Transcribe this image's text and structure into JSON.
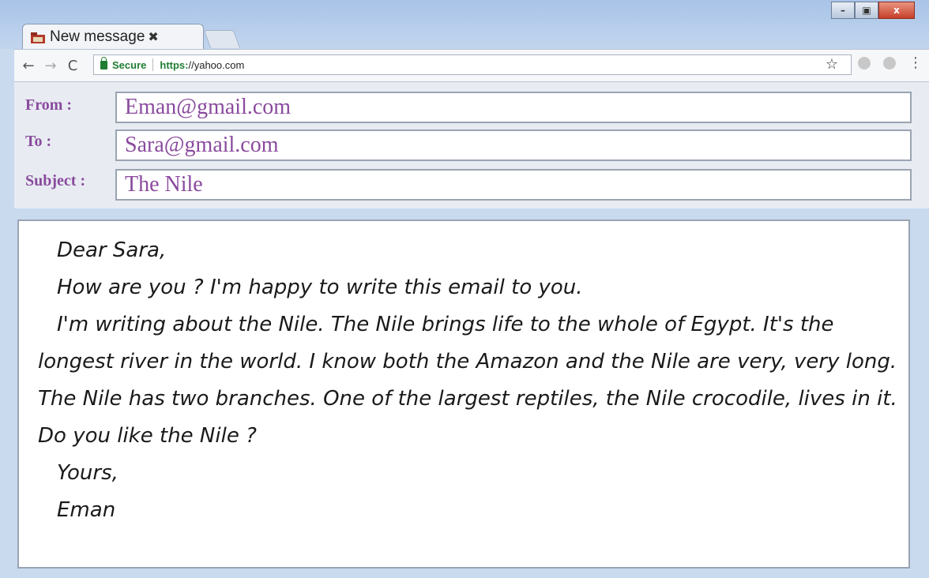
{
  "tab": {
    "title": "New message",
    "close": "✖"
  },
  "window_controls": {
    "minimize": "–",
    "maximize": "▣",
    "close": "x"
  },
  "nav": {
    "back": "←",
    "forward": "→",
    "reload": "C"
  },
  "address": {
    "secure_label": "Secure",
    "scheme": "https:",
    "host": "//yahoo.com",
    "star": "☆",
    "menu": "⋮"
  },
  "form": {
    "from_label": "From :",
    "from_value": "Eman@gmail.com",
    "to_label": "To :",
    "to_value": "Sara@gmail.com",
    "subject_label": "Subject :",
    "subject_value": "The Nile"
  },
  "body": {
    "greeting": "Dear Sara,",
    "line1": "How are you ? I'm happy to write this email to you.",
    "paragraph": "I'm writing about the Nile. The Nile brings life to the whole of Egypt. It's the longest river in the world. I know both the Amazon and the Nile are very, very long. The Nile has two branches. One of the largest reptiles, the Nile crocodile, lives in it. Do you like the Nile ?",
    "closing": "Yours,",
    "signature": "Eman"
  },
  "colors": {
    "label_purple": "#8a4a9e",
    "secure_green": "#1e7d32",
    "close_red": "#c6402a"
  },
  "icons": [
    "folder-icon",
    "close-icon",
    "back-icon",
    "forward-icon",
    "reload-icon",
    "lock-icon",
    "star-icon",
    "extension-icon",
    "menu-icon"
  ]
}
